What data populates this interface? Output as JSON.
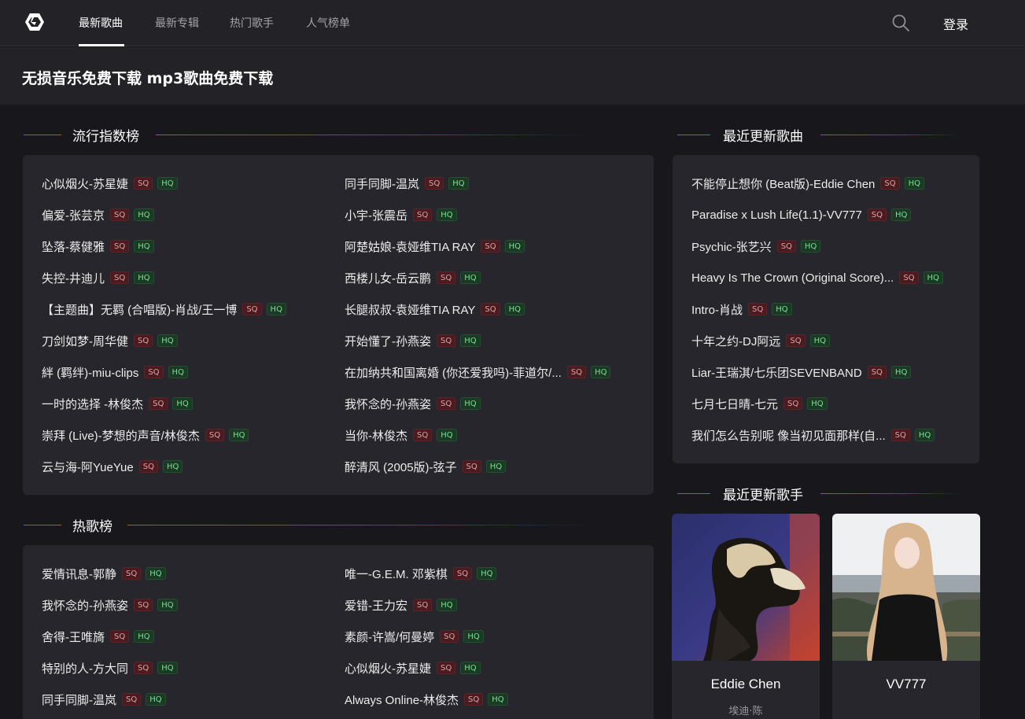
{
  "nav": {
    "items": [
      "最新歌曲",
      "最新专辑",
      "热门歌手",
      "人气榜单"
    ],
    "login": "登录"
  },
  "banner": {
    "title": "无损音乐免费下载 mp3歌曲免费下载"
  },
  "badges": {
    "sq": "SQ",
    "hq": "HQ"
  },
  "popular": {
    "title": "流行指数榜",
    "left": [
      "心似烟火-苏星婕",
      "偏爱-张芸京",
      "坠落-蔡健雅",
      "失控-井迪儿",
      "【主题曲】无羁 (合唱版)-肖战/王一博",
      "刀剑如梦-周华健",
      "絆 (羁绊)-miu-clips",
      "一时的选择 -林俊杰",
      "崇拜 (Live)-梦想的声音/林俊杰",
      "云与海-阿YueYue"
    ],
    "right": [
      "同手同脚-温岚",
      "小宇-张震岳",
      "阿楚姑娘-袁娅维TIA RAY",
      "西楼儿女-岳云鹏",
      "长腿叔叔-袁娅维TIA RAY",
      "开始懂了-孙燕姿",
      "在加纳共和国离婚 (你还爱我吗)-菲道尔/...",
      "我怀念的-孙燕姿",
      "当你-林俊杰",
      "醉清风 (2005版)-弦子"
    ]
  },
  "hot": {
    "title": "热歌榜",
    "left": [
      "爱情讯息-郭静",
      "我怀念的-孙燕姿",
      "舍得-王唯旖",
      "特别的人-方大同",
      "同手同脚-温岚"
    ],
    "right": [
      "唯一-G.E.M. 邓紫棋",
      "爱错-王力宏",
      "素颜-许嵩/何曼婷",
      "心似烟火-苏星婕",
      "Always Online-林俊杰"
    ]
  },
  "recent_songs": {
    "title": "最近更新歌曲",
    "items": [
      "不能停止想你 (Beat版)-Eddie Chen",
      "Paradise x Lush Life(1.1)-VV777",
      "Psychic-张艺兴",
      "Heavy Is The Crown (Original Score)...",
      "Intro-肖战",
      "十年之约-DJ阿远",
      "Liar-王瑞淇/七乐团SEVENBAND",
      "七月七日晴-七元",
      "我们怎么告别呢 像当初见面那样(自..."
    ]
  },
  "recent_artists": {
    "title": "最近更新歌手",
    "items": [
      {
        "name": "Eddie Chen",
        "sub": "埃迪·陈"
      },
      {
        "name": "VV777",
        "sub": ""
      }
    ]
  }
}
